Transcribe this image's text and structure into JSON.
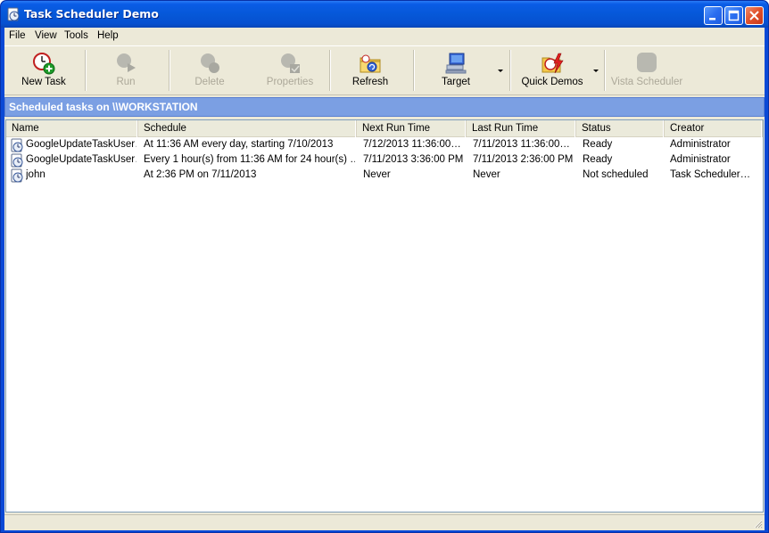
{
  "window": {
    "title": "Task Scheduler Demo",
    "title_icon": "task-scheduler-app-icon"
  },
  "menu": {
    "items": [
      {
        "label": "File"
      },
      {
        "label": "View"
      },
      {
        "label": "Tools"
      },
      {
        "label": "Help"
      }
    ]
  },
  "toolbar": {
    "buttons": [
      {
        "label": "New Task",
        "icon": "clock-add-icon",
        "enabled": true
      },
      {
        "label": "Run",
        "icon": "run-icon",
        "enabled": false
      },
      {
        "label": "Delete",
        "icon": "delete-icon",
        "enabled": false
      },
      {
        "label": "Properties",
        "icon": "properties-icon",
        "enabled": false
      },
      {
        "label": "Refresh",
        "icon": "refresh-folder-icon",
        "enabled": true
      },
      {
        "label": "Target",
        "icon": "computer-target-icon",
        "enabled": true,
        "dropdown": true
      },
      {
        "label": "Quick Demos",
        "icon": "quick-demos-icon",
        "enabled": true,
        "dropdown": true
      },
      {
        "label": "Vista Scheduler",
        "icon": "vista-scheduler-icon",
        "enabled": false
      }
    ]
  },
  "banner": {
    "text": "Scheduled tasks on \\\\WORKSTATION"
  },
  "table": {
    "columns": [
      "Name",
      "Schedule",
      "Next Run Time",
      "Last Run Time",
      "Status",
      "Creator"
    ],
    "rows": [
      {
        "name": "GoogleUpdateTaskUser…",
        "schedule": "At 11:36 AM every day, starting 7/10/2013",
        "next_run": "7/12/2013 11:36:00…",
        "last_run": "7/11/2013 11:36:00…",
        "status": "Ready",
        "creator": "Administrator"
      },
      {
        "name": "GoogleUpdateTaskUser…",
        "schedule": "Every 1 hour(s) from 11:36 AM for 24 hour(s) …",
        "next_run": "7/11/2013 3:36:00 PM",
        "last_run": "7/11/2013 2:36:00 PM",
        "status": "Ready",
        "creator": "Administrator"
      },
      {
        "name": "john",
        "schedule": "At 2:36 PM on 7/11/2013",
        "next_run": "Never",
        "last_run": "Never",
        "status": "Not scheduled",
        "creator": "Task Scheduler…"
      }
    ]
  },
  "colors": {
    "titlebar": "#0a58d8",
    "banner": "#7b9fe3",
    "chrome": "#ece9d8",
    "disabled_text": "#aca899"
  }
}
